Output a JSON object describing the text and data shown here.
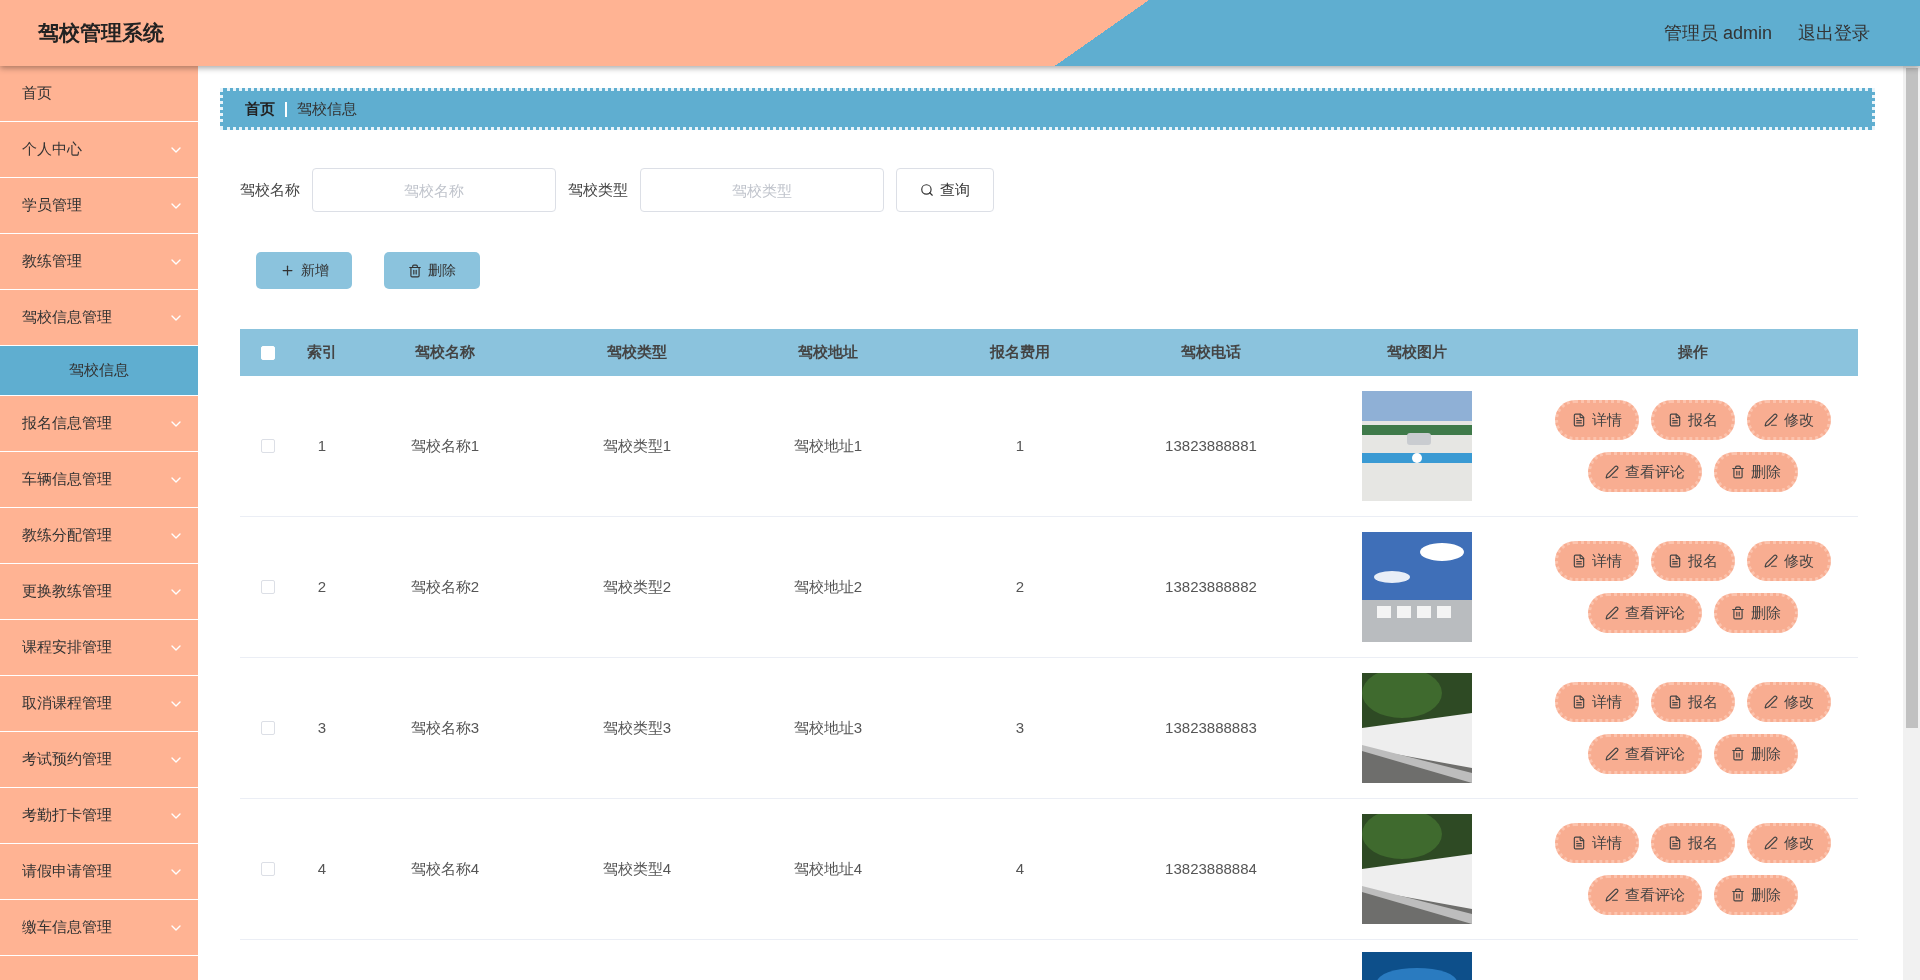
{
  "header": {
    "title": "驾校管理系统",
    "user": "管理员 admin",
    "logout": "退出登录"
  },
  "sidebar": {
    "items": [
      {
        "label": "首页",
        "selected": false,
        "has_arrow": false
      },
      {
        "label": "个人中心",
        "selected": false,
        "has_arrow": true
      },
      {
        "label": "学员管理",
        "selected": false,
        "has_arrow": true
      },
      {
        "label": "教练管理",
        "selected": false,
        "has_arrow": true
      },
      {
        "label": "驾校信息管理",
        "selected": false,
        "has_arrow": true,
        "children": [
          {
            "label": "驾校信息",
            "selected": true
          }
        ]
      },
      {
        "label": "报名信息管理",
        "selected": false,
        "has_arrow": true
      },
      {
        "label": "车辆信息管理",
        "selected": false,
        "has_arrow": true
      },
      {
        "label": "教练分配管理",
        "selected": false,
        "has_arrow": true
      },
      {
        "label": "更换教练管理",
        "selected": false,
        "has_arrow": true
      },
      {
        "label": "课程安排管理",
        "selected": false,
        "has_arrow": true
      },
      {
        "label": "取消课程管理",
        "selected": false,
        "has_arrow": true
      },
      {
        "label": "考试预约管理",
        "selected": false,
        "has_arrow": true
      },
      {
        "label": "考勤打卡管理",
        "selected": false,
        "has_arrow": true
      },
      {
        "label": "请假申请管理",
        "selected": false,
        "has_arrow": true
      },
      {
        "label": "缴车信息管理",
        "selected": false,
        "has_arrow": true
      }
    ]
  },
  "breadcrumb": [
    "首页",
    "驾校信息"
  ],
  "search": {
    "fields": [
      {
        "label": "驾校名称",
        "placeholder": "驾校名称"
      },
      {
        "label": "驾校类型",
        "placeholder": "驾校类型"
      }
    ],
    "button": "查询"
  },
  "toolbar": [
    {
      "kind": "add",
      "label": "新增"
    },
    {
      "kind": "delete",
      "label": "删除"
    }
  ],
  "table": {
    "select_all_checked": false,
    "columns": [
      "索引",
      "驾校名称",
      "驾校类型",
      "驾校地址",
      "报名费用",
      "驾校电话",
      "驾校图片",
      "操作"
    ],
    "rows": [
      {
        "checked": false,
        "cells": [
          "1",
          "驾校名称1",
          "驾校类型1",
          "驾校地址1",
          "1",
          "13823888881"
        ],
        "picture": {
          "kind": "picture"
        },
        "actions": [
          {
            "kind": "detail",
            "label": "详情"
          },
          {
            "kind": "enroll",
            "label": "报名"
          },
          {
            "kind": "edit",
            "label": "修改"
          },
          {
            "kind": "comment",
            "label": "查看评论"
          },
          {
            "kind": "delete",
            "label": "删除"
          }
        ]
      },
      {
        "checked": false,
        "cells": [
          "2",
          "驾校名称2",
          "驾校类型2",
          "驾校地址2",
          "2",
          "13823888882"
        ],
        "picture": {
          "kind": "picture"
        },
        "actions": [
          {
            "kind": "detail",
            "label": "详情"
          },
          {
            "kind": "enroll",
            "label": "报名"
          },
          {
            "kind": "edit",
            "label": "修改"
          },
          {
            "kind": "comment",
            "label": "查看评论"
          },
          {
            "kind": "delete",
            "label": "删除"
          }
        ]
      },
      {
        "checked": false,
        "cells": [
          "3",
          "驾校名称3",
          "驾校类型3",
          "驾校地址3",
          "3",
          "13823888883"
        ],
        "picture": {
          "kind": "picture"
        },
        "actions": [
          {
            "kind": "detail",
            "label": "详情"
          },
          {
            "kind": "enroll",
            "label": "报名"
          },
          {
            "kind": "edit",
            "label": "修改"
          },
          {
            "kind": "comment",
            "label": "查看评论"
          },
          {
            "kind": "delete",
            "label": "删除"
          }
        ]
      },
      {
        "checked": false,
        "cells": [
          "4",
          "驾校名称4",
          "驾校类型4",
          "驾校地址4",
          "4",
          "13823888884"
        ],
        "picture": {
          "kind": "picture"
        },
        "actions": [
          {
            "kind": "detail",
            "label": "详情"
          },
          {
            "kind": "enroll",
            "label": "报名"
          },
          {
            "kind": "edit",
            "label": "修改"
          },
          {
            "kind": "comment",
            "label": "查看评论"
          },
          {
            "kind": "delete",
            "label": "删除"
          }
        ]
      }
    ]
  }
}
